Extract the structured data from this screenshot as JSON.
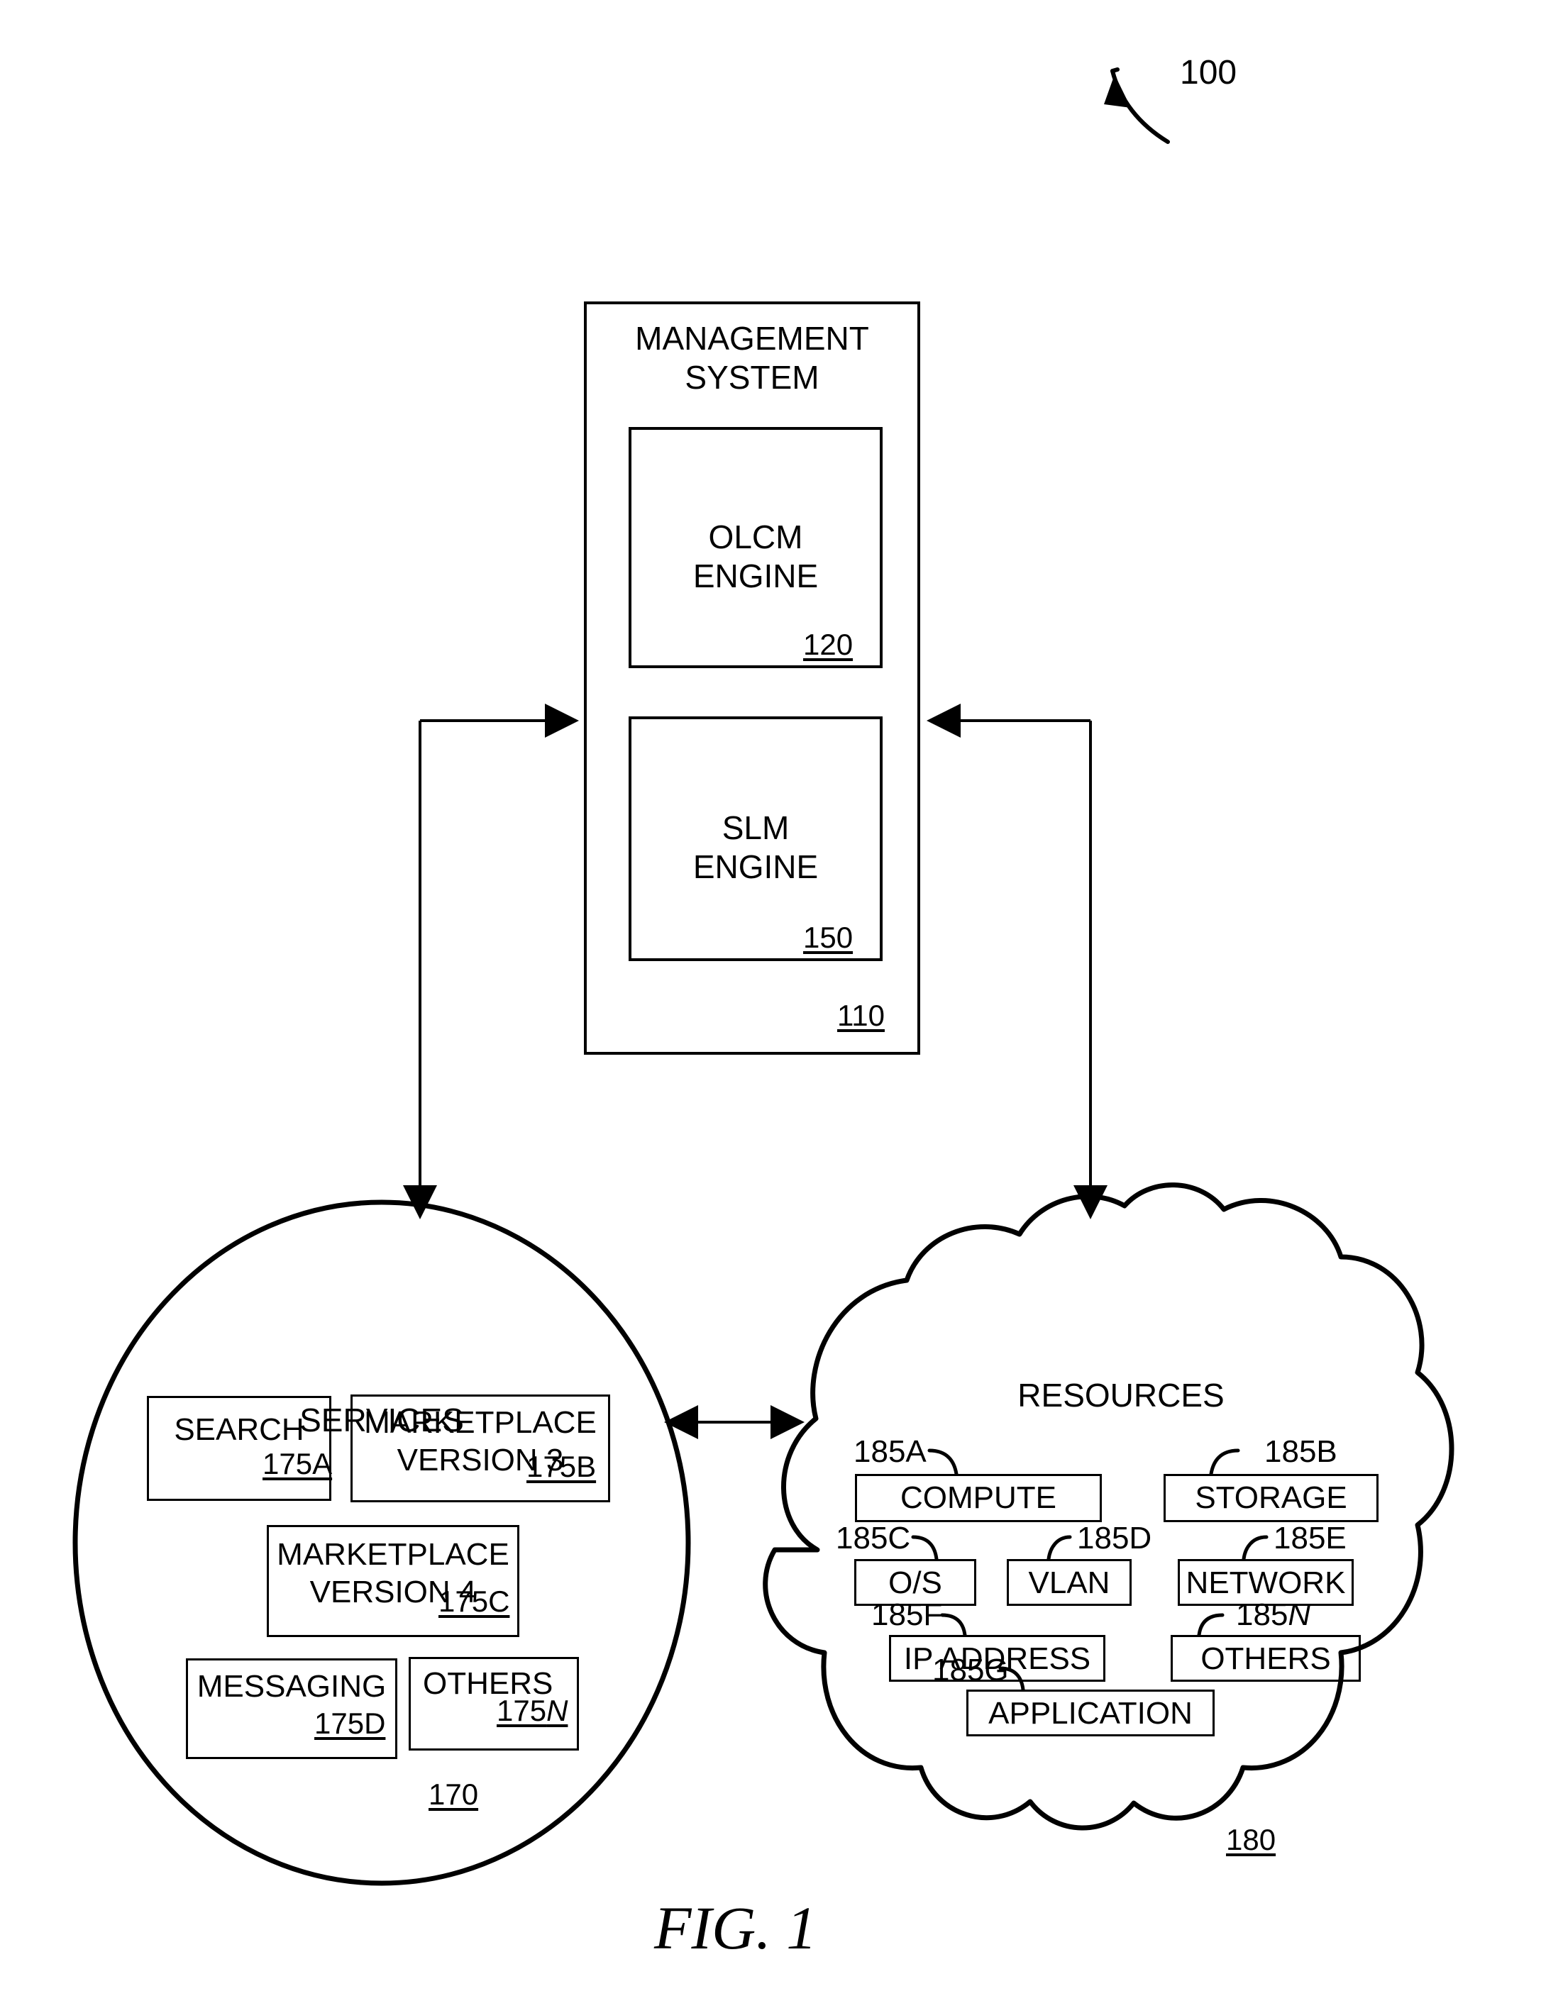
{
  "figure": {
    "caption": "FIG. 1",
    "system_ref": "100"
  },
  "management_system": {
    "title": "MANAGEMENT\nSYSTEM",
    "ref": "110",
    "engines": [
      {
        "title": "OLCM\nENGINE",
        "ref": "120"
      },
      {
        "title": "SLM\nENGINE",
        "ref": "150"
      }
    ]
  },
  "services": {
    "title": "SERVICES",
    "ref": "170",
    "items": [
      {
        "label": "SEARCH",
        "ref": "175A",
        "ref_italic_suffix": ""
      },
      {
        "label": "MARKETPLACE\nVERSION 3",
        "ref": "175B",
        "ref_italic_suffix": ""
      },
      {
        "label": "MARKETPLACE\nVERSION 4",
        "ref": "175C",
        "ref_italic_suffix": ""
      },
      {
        "label": "MESSAGING",
        "ref": "175D",
        "ref_italic_suffix": ""
      },
      {
        "label": "OTHERS",
        "ref": "175",
        "ref_italic_suffix": "N"
      }
    ]
  },
  "resources": {
    "title": "RESOURCES",
    "ref": "180",
    "items": [
      {
        "label": "COMPUTE",
        "ref": "185A",
        "ref_italic_suffix": ""
      },
      {
        "label": "STORAGE",
        "ref": "185B",
        "ref_italic_suffix": ""
      },
      {
        "label": "O/S",
        "ref": "185C",
        "ref_italic_suffix": ""
      },
      {
        "label": "VLAN",
        "ref": "185D",
        "ref_italic_suffix": ""
      },
      {
        "label": "NETWORK",
        "ref": "185E",
        "ref_italic_suffix": ""
      },
      {
        "label": "IP ADDRESS",
        "ref": "185F",
        "ref_italic_suffix": ""
      },
      {
        "label": "OTHERS",
        "ref": "185",
        "ref_italic_suffix": "N"
      },
      {
        "label": "APPLICATION",
        "ref": "185G",
        "ref_italic_suffix": ""
      }
    ]
  },
  "colors": {
    "stroke": "#000000",
    "background": "#ffffff"
  }
}
